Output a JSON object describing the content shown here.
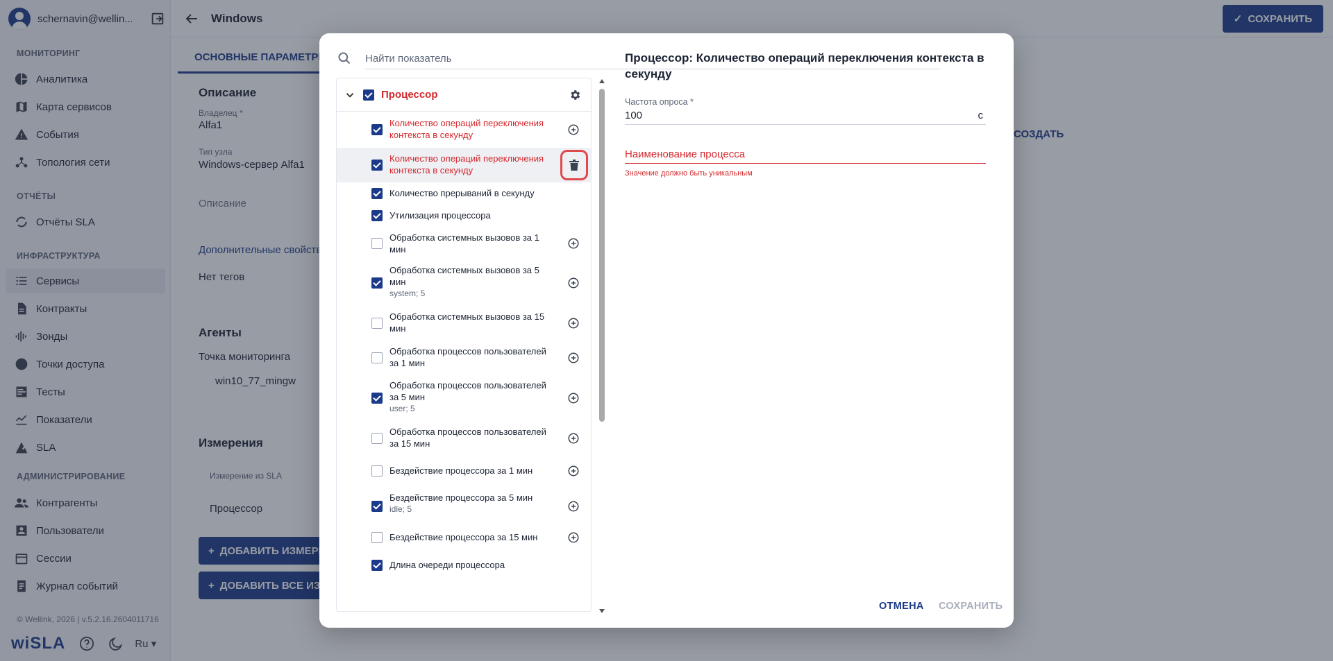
{
  "user": {
    "name": "schernavin@wellin..."
  },
  "sidebar": {
    "sections": [
      "МОНИТОРИНГ",
      "ОТЧЁТЫ",
      "ИНФРАСТРУКТУРА",
      "АДМИНИСТРИРОВАНИЕ"
    ],
    "items": [
      {
        "label": "Аналитика",
        "icon": "pie-chart-icon"
      },
      {
        "label": "Карта сервисов",
        "icon": "map-icon"
      },
      {
        "label": "События",
        "icon": "warning-icon"
      },
      {
        "label": "Топология сети",
        "icon": "topology-icon"
      },
      {
        "label": "Отчёты SLA",
        "icon": "refresh-report-icon"
      },
      {
        "label": "Сервисы",
        "icon": "list-icon"
      },
      {
        "label": "Контракты",
        "icon": "document-icon"
      },
      {
        "label": "Зонды",
        "icon": "signal-icon"
      },
      {
        "label": "Точки доступа",
        "icon": "circle-icon"
      },
      {
        "label": "Тесты",
        "icon": "test-icon"
      },
      {
        "label": "Показатели",
        "icon": "metrics-icon"
      },
      {
        "label": "SLA",
        "icon": "sla-icon"
      },
      {
        "label": "Контрагенты",
        "icon": "people-icon"
      },
      {
        "label": "Пользователи",
        "icon": "user-card-icon"
      },
      {
        "label": "Сессии",
        "icon": "calendar-icon"
      },
      {
        "label": "Журнал событий",
        "icon": "log-icon"
      }
    ],
    "copyright": "© Wellink, 2026 | v.5.2.16.2604011716",
    "logo": "wiSLA",
    "lang": "Ru"
  },
  "header": {
    "title": "Windows",
    "save_label": "СОХРАНИТЬ"
  },
  "tabs": {
    "main": "ОСНОВНЫЕ ПАРАМЕТРЫ"
  },
  "page": {
    "description_title": "Описание",
    "owner_label": "Владелец *",
    "owner_value": "Alfa1",
    "node_type_label": "Тип узла",
    "node_type_value": "Windows-сервер Alfa1",
    "description_placeholder": "Описание",
    "extra_props": "Дополнительные свойства",
    "no_tags": "Нет тегов",
    "agents_title": "Агенты",
    "monitoring_point": "Точка мониторинга",
    "agent_value": "win10_77_mingw",
    "measures_title": "Измерения",
    "measure_col": "Измерение из SLA",
    "measure_value": "Процессор",
    "add_measure": "ДОБАВИТЬ ИЗМЕРЕНИЕ",
    "add_all": "ДОБАВИТЬ ВСЕ ИЗМЕРЕНИЯ",
    "create": "СОЗДАТЬ"
  },
  "modal": {
    "search_placeholder": "Найти показатель",
    "group": "Процессор",
    "rows": [
      {
        "text": "Количество операций переключения контекста в секунду",
        "sub": "",
        "checked": true,
        "error": true,
        "action": "plus"
      },
      {
        "text": "Количество операций переключения контекста в секунду",
        "sub": "",
        "checked": true,
        "error": true,
        "action": "trash"
      },
      {
        "text": "Количество прерываний в секунду",
        "sub": "",
        "checked": true,
        "error": false,
        "action": "none"
      },
      {
        "text": "Утилизация процессора",
        "sub": "",
        "checked": true,
        "error": false,
        "action": "none"
      },
      {
        "text": "Обработка системных вызовов за 1 мин",
        "sub": "",
        "checked": false,
        "error": false,
        "action": "plus"
      },
      {
        "text": "Обработка системных вызовов за 5 мин",
        "sub": "system; 5",
        "checked": true,
        "error": false,
        "action": "plus"
      },
      {
        "text": "Обработка системных вызовов за 15 мин",
        "sub": "",
        "checked": false,
        "error": false,
        "action": "plus"
      },
      {
        "text": "Обработка процессов пользователей за 1 мин",
        "sub": "",
        "checked": false,
        "error": false,
        "action": "plus"
      },
      {
        "text": "Обработка процессов пользователей за 5 мин",
        "sub": "user; 5",
        "checked": true,
        "error": false,
        "action": "plus"
      },
      {
        "text": "Обработка процессов пользователей за 15 мин",
        "sub": "",
        "checked": false,
        "error": false,
        "action": "plus"
      },
      {
        "text": "Бездействие процессора за 1 мин",
        "sub": "",
        "checked": false,
        "error": false,
        "action": "plus"
      },
      {
        "text": "Бездействие процессора за 5 мин",
        "sub": "idle; 5",
        "checked": true,
        "error": false,
        "action": "plus"
      },
      {
        "text": "Бездействие процессора за 15 мин",
        "sub": "",
        "checked": false,
        "error": false,
        "action": "plus"
      },
      {
        "text": "Длина очереди процессора",
        "sub": "",
        "checked": true,
        "error": false,
        "action": "none"
      }
    ],
    "detail_title": "Процессор: Количество операций переключения контекста в секунду",
    "freq_label": "Частота опроса *",
    "freq_value": "100",
    "freq_unit": "с",
    "process_label": "Наименование процесса",
    "process_error": "Значение должно быть уникальным",
    "cancel": "ОТМЕНА",
    "save": "СОХРАНИТЬ"
  }
}
